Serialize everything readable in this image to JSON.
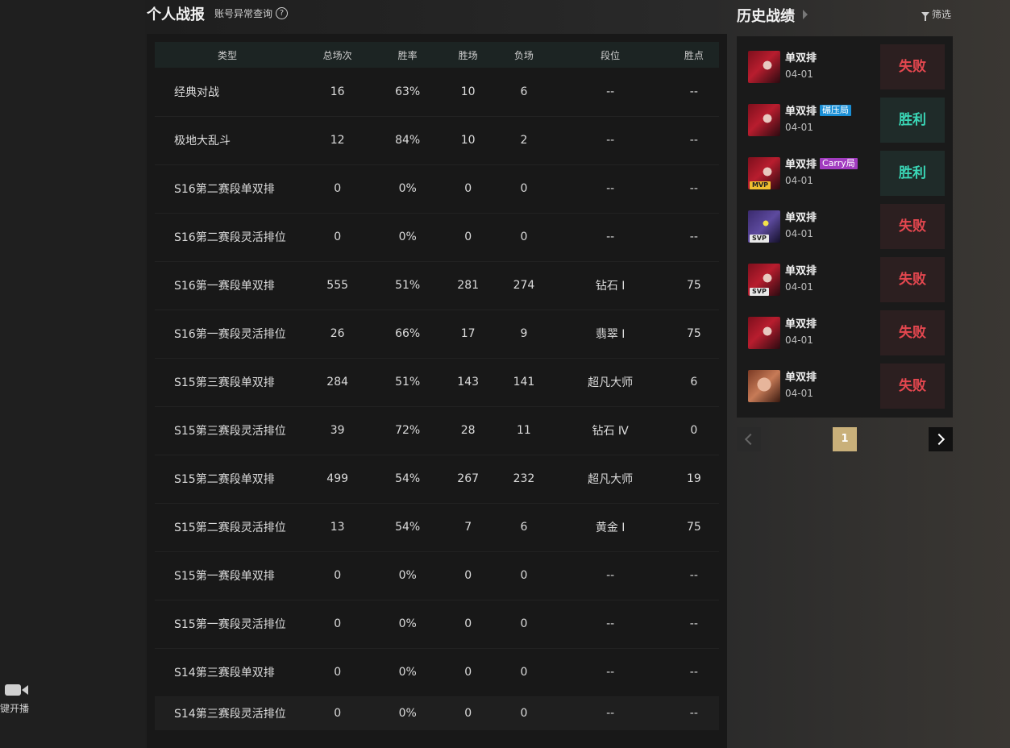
{
  "left": {
    "live_label": "键开播"
  },
  "header": {
    "title": "个人战报",
    "abnormal_link": "账号异常查询",
    "help_glyph": "?"
  },
  "stats": {
    "columns": [
      "类型",
      "总场次",
      "胜率",
      "胜场",
      "负场",
      "段位",
      "胜点"
    ],
    "rows": [
      [
        "经典对战",
        "16",
        "63%",
        "10",
        "6",
        "--",
        "--"
      ],
      [
        "极地大乱斗",
        "12",
        "84%",
        "10",
        "2",
        "--",
        "--"
      ],
      [
        "S16第二赛段单双排",
        "0",
        "0%",
        "0",
        "0",
        "--",
        "--"
      ],
      [
        "S16第二赛段灵活排位",
        "0",
        "0%",
        "0",
        "0",
        "--",
        "--"
      ],
      [
        "S16第一赛段单双排",
        "555",
        "51%",
        "281",
        "274",
        "钻石 Ⅰ",
        "75"
      ],
      [
        "S16第一赛段灵活排位",
        "26",
        "66%",
        "17",
        "9",
        "翡翠 Ⅰ",
        "75"
      ],
      [
        "S15第三赛段单双排",
        "284",
        "51%",
        "143",
        "141",
        "超凡大师",
        "6"
      ],
      [
        "S15第三赛段灵活排位",
        "39",
        "72%",
        "28",
        "11",
        "钻石 Ⅳ",
        "0"
      ],
      [
        "S15第二赛段单双排",
        "499",
        "54%",
        "267",
        "232",
        "超凡大师",
        "19"
      ],
      [
        "S15第二赛段灵活排位",
        "13",
        "54%",
        "7",
        "6",
        "黄金 Ⅰ",
        "75"
      ],
      [
        "S15第一赛段单双排",
        "0",
        "0%",
        "0",
        "0",
        "--",
        "--"
      ],
      [
        "S15第一赛段灵活排位",
        "0",
        "0%",
        "0",
        "0",
        "--",
        "--"
      ],
      [
        "S14第三赛段单双排",
        "0",
        "0%",
        "0",
        "0",
        "--",
        "--"
      ],
      [
        "S14第三赛段灵活排位",
        "0",
        "0%",
        "0",
        "0",
        "--",
        "--"
      ]
    ]
  },
  "history": {
    "title": "历史战绩",
    "filter_label": "筛选",
    "matches": [
      {
        "mode": "单双排",
        "tag": "",
        "tag_color": "",
        "badge": "",
        "date": "04-01",
        "result": "失败",
        "outcome": "lose",
        "avatar": "red"
      },
      {
        "mode": "单双排",
        "tag": "碾压局",
        "tag_color": "blue",
        "badge": "",
        "date": "04-01",
        "result": "胜利",
        "outcome": "win",
        "avatar": "red"
      },
      {
        "mode": "单双排",
        "tag": "Carry局",
        "tag_color": "purple",
        "badge": "MVP",
        "date": "04-01",
        "result": "胜利",
        "outcome": "win",
        "avatar": "red"
      },
      {
        "mode": "单双排",
        "tag": "",
        "tag_color": "",
        "badge": "SVP",
        "date": "04-01",
        "result": "失败",
        "outcome": "lose",
        "avatar": "purple"
      },
      {
        "mode": "单双排",
        "tag": "",
        "tag_color": "",
        "badge": "SVP",
        "date": "04-01",
        "result": "失败",
        "outcome": "lose",
        "avatar": "red"
      },
      {
        "mode": "单双排",
        "tag": "",
        "tag_color": "",
        "badge": "",
        "date": "04-01",
        "result": "失败",
        "outcome": "lose",
        "avatar": "red"
      },
      {
        "mode": "单双排",
        "tag": "",
        "tag_color": "",
        "badge": "",
        "date": "04-01",
        "result": "失败",
        "outcome": "lose",
        "avatar": "pale"
      }
    ],
    "pagination": {
      "current_page": "1"
    }
  },
  "colors": {
    "lose": "#e4474f",
    "win": "#3ad6b6",
    "page_active": "#c9b07a"
  }
}
